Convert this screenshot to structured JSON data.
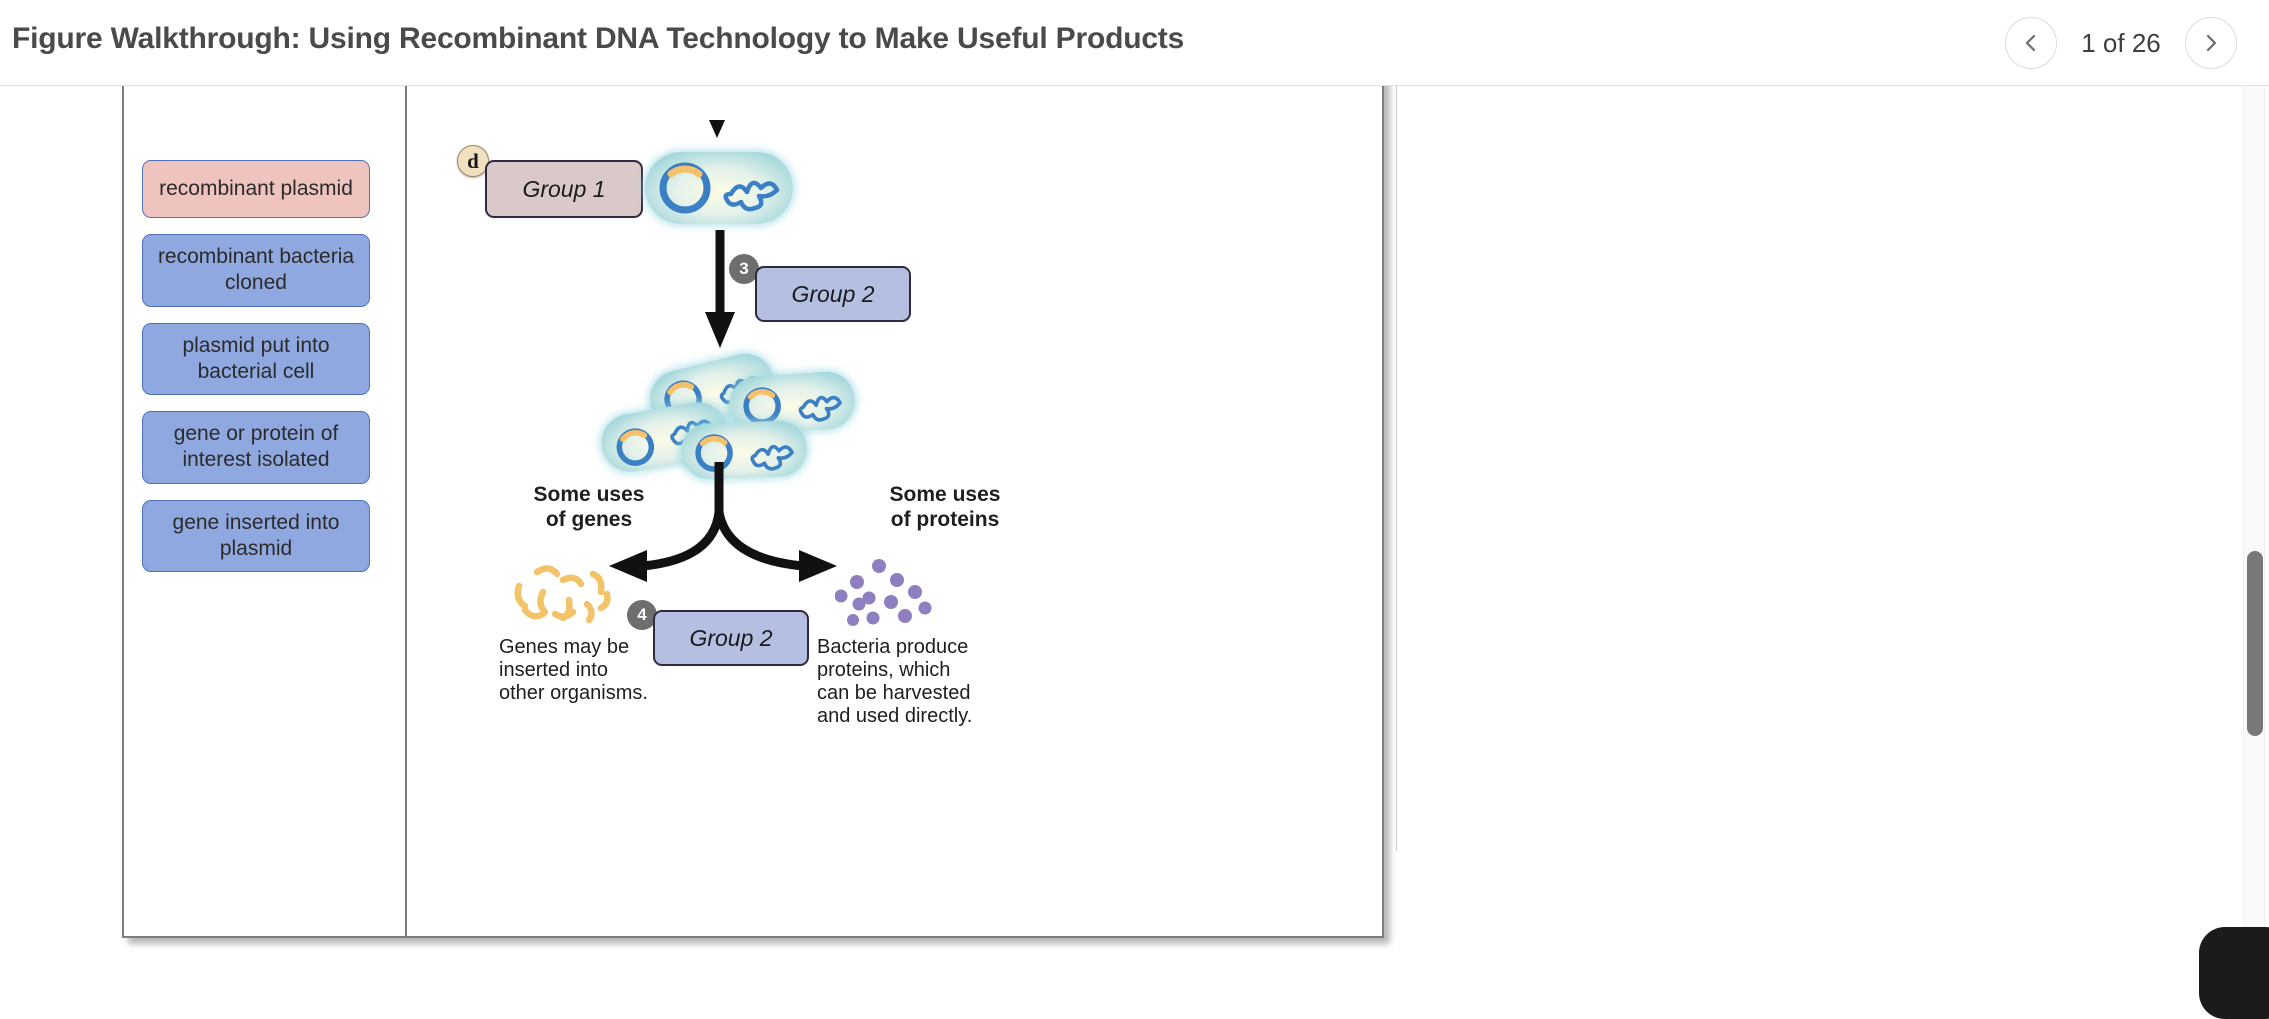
{
  "header": {
    "title": "Figure Walkthrough: Using Recombinant DNA Technology to Make Useful Products",
    "pager": {
      "prev_icon": "chevron-left-icon",
      "next_icon": "chevron-right-icon",
      "label": "1 of 26",
      "current": 1,
      "total": 26
    }
  },
  "labels": {
    "items": [
      {
        "text": "recombinant plasmid",
        "color": "pink"
      },
      {
        "text": "recombinant bacteria cloned",
        "color": "blue"
      },
      {
        "text": "plasmid put into bacterial cell",
        "color": "blue"
      },
      {
        "text": "gene or protein of interest isolated",
        "color": "blue"
      },
      {
        "text": "gene inserted into plasmid",
        "color": "blue"
      }
    ]
  },
  "figure": {
    "markers": {
      "letter_d": "d",
      "step3": "3",
      "step4": "4"
    },
    "dropzones": [
      {
        "label": "Group 1",
        "color": "pink"
      },
      {
        "label": "Group 2",
        "color": "blue"
      },
      {
        "label": "Group 2",
        "color": "blue"
      }
    ],
    "headings": {
      "genes": "Some uses\nof genes",
      "proteins": "Some uses\nof proteins"
    },
    "captions": {
      "genes": "Genes may be\ninserted into\nother organisms.",
      "proteins": "Bacteria produce\nproteins, which\ncan be harvested\nand used directly."
    }
  },
  "colors": {
    "label_pink": "#efc3be",
    "label_blue": "#8fa8e0",
    "label_border": "#4f70b8",
    "dropzone_pink": "#d9c9c9",
    "dropzone_blue": "#b5bfe2",
    "dropzone_border": "#2f2a3f",
    "marker_gray": "#6e6e6e",
    "marker_tan": "#f0e0bf",
    "plasmid_blue": "#3b7fc4",
    "plasmid_orange": "#f5c06a",
    "protein_purple": "#8f7fc0",
    "gene_orange": "#f3c36a",
    "bacterium_teal": "#8ccfd6",
    "title_gray": "#4a4a4a"
  }
}
